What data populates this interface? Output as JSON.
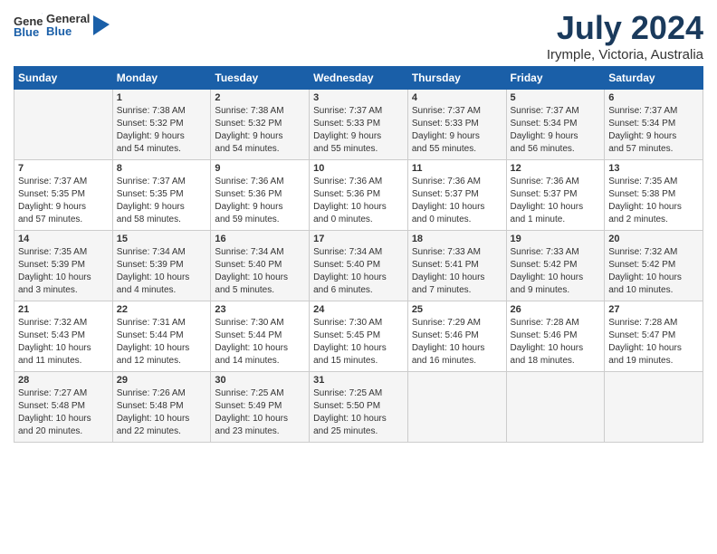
{
  "header": {
    "logo_general": "General",
    "logo_blue": "Blue",
    "month_title": "July 2024",
    "location": "Irymple, Victoria, Australia"
  },
  "days_of_week": [
    "Sunday",
    "Monday",
    "Tuesday",
    "Wednesday",
    "Thursday",
    "Friday",
    "Saturday"
  ],
  "weeks": [
    [
      {
        "day": "",
        "info": ""
      },
      {
        "day": "1",
        "info": "Sunrise: 7:38 AM\nSunset: 5:32 PM\nDaylight: 9 hours\nand 54 minutes."
      },
      {
        "day": "2",
        "info": "Sunrise: 7:38 AM\nSunset: 5:32 PM\nDaylight: 9 hours\nand 54 minutes."
      },
      {
        "day": "3",
        "info": "Sunrise: 7:37 AM\nSunset: 5:33 PM\nDaylight: 9 hours\nand 55 minutes."
      },
      {
        "day": "4",
        "info": "Sunrise: 7:37 AM\nSunset: 5:33 PM\nDaylight: 9 hours\nand 55 minutes."
      },
      {
        "day": "5",
        "info": "Sunrise: 7:37 AM\nSunset: 5:34 PM\nDaylight: 9 hours\nand 56 minutes."
      },
      {
        "day": "6",
        "info": "Sunrise: 7:37 AM\nSunset: 5:34 PM\nDaylight: 9 hours\nand 57 minutes."
      }
    ],
    [
      {
        "day": "7",
        "info": "Sunrise: 7:37 AM\nSunset: 5:35 PM\nDaylight: 9 hours\nand 57 minutes."
      },
      {
        "day": "8",
        "info": "Sunrise: 7:37 AM\nSunset: 5:35 PM\nDaylight: 9 hours\nand 58 minutes."
      },
      {
        "day": "9",
        "info": "Sunrise: 7:36 AM\nSunset: 5:36 PM\nDaylight: 9 hours\nand 59 minutes."
      },
      {
        "day": "10",
        "info": "Sunrise: 7:36 AM\nSunset: 5:36 PM\nDaylight: 10 hours\nand 0 minutes."
      },
      {
        "day": "11",
        "info": "Sunrise: 7:36 AM\nSunset: 5:37 PM\nDaylight: 10 hours\nand 0 minutes."
      },
      {
        "day": "12",
        "info": "Sunrise: 7:36 AM\nSunset: 5:37 PM\nDaylight: 10 hours\nand 1 minute."
      },
      {
        "day": "13",
        "info": "Sunrise: 7:35 AM\nSunset: 5:38 PM\nDaylight: 10 hours\nand 2 minutes."
      }
    ],
    [
      {
        "day": "14",
        "info": "Sunrise: 7:35 AM\nSunset: 5:39 PM\nDaylight: 10 hours\nand 3 minutes."
      },
      {
        "day": "15",
        "info": "Sunrise: 7:34 AM\nSunset: 5:39 PM\nDaylight: 10 hours\nand 4 minutes."
      },
      {
        "day": "16",
        "info": "Sunrise: 7:34 AM\nSunset: 5:40 PM\nDaylight: 10 hours\nand 5 minutes."
      },
      {
        "day": "17",
        "info": "Sunrise: 7:34 AM\nSunset: 5:40 PM\nDaylight: 10 hours\nand 6 minutes."
      },
      {
        "day": "18",
        "info": "Sunrise: 7:33 AM\nSunset: 5:41 PM\nDaylight: 10 hours\nand 7 minutes."
      },
      {
        "day": "19",
        "info": "Sunrise: 7:33 AM\nSunset: 5:42 PM\nDaylight: 10 hours\nand 9 minutes."
      },
      {
        "day": "20",
        "info": "Sunrise: 7:32 AM\nSunset: 5:42 PM\nDaylight: 10 hours\nand 10 minutes."
      }
    ],
    [
      {
        "day": "21",
        "info": "Sunrise: 7:32 AM\nSunset: 5:43 PM\nDaylight: 10 hours\nand 11 minutes."
      },
      {
        "day": "22",
        "info": "Sunrise: 7:31 AM\nSunset: 5:44 PM\nDaylight: 10 hours\nand 12 minutes."
      },
      {
        "day": "23",
        "info": "Sunrise: 7:30 AM\nSunset: 5:44 PM\nDaylight: 10 hours\nand 14 minutes."
      },
      {
        "day": "24",
        "info": "Sunrise: 7:30 AM\nSunset: 5:45 PM\nDaylight: 10 hours\nand 15 minutes."
      },
      {
        "day": "25",
        "info": "Sunrise: 7:29 AM\nSunset: 5:46 PM\nDaylight: 10 hours\nand 16 minutes."
      },
      {
        "day": "26",
        "info": "Sunrise: 7:28 AM\nSunset: 5:46 PM\nDaylight: 10 hours\nand 18 minutes."
      },
      {
        "day": "27",
        "info": "Sunrise: 7:28 AM\nSunset: 5:47 PM\nDaylight: 10 hours\nand 19 minutes."
      }
    ],
    [
      {
        "day": "28",
        "info": "Sunrise: 7:27 AM\nSunset: 5:48 PM\nDaylight: 10 hours\nand 20 minutes."
      },
      {
        "day": "29",
        "info": "Sunrise: 7:26 AM\nSunset: 5:48 PM\nDaylight: 10 hours\nand 22 minutes."
      },
      {
        "day": "30",
        "info": "Sunrise: 7:25 AM\nSunset: 5:49 PM\nDaylight: 10 hours\nand 23 minutes."
      },
      {
        "day": "31",
        "info": "Sunrise: 7:25 AM\nSunset: 5:50 PM\nDaylight: 10 hours\nand 25 minutes."
      },
      {
        "day": "",
        "info": ""
      },
      {
        "day": "",
        "info": ""
      },
      {
        "day": "",
        "info": ""
      }
    ]
  ]
}
